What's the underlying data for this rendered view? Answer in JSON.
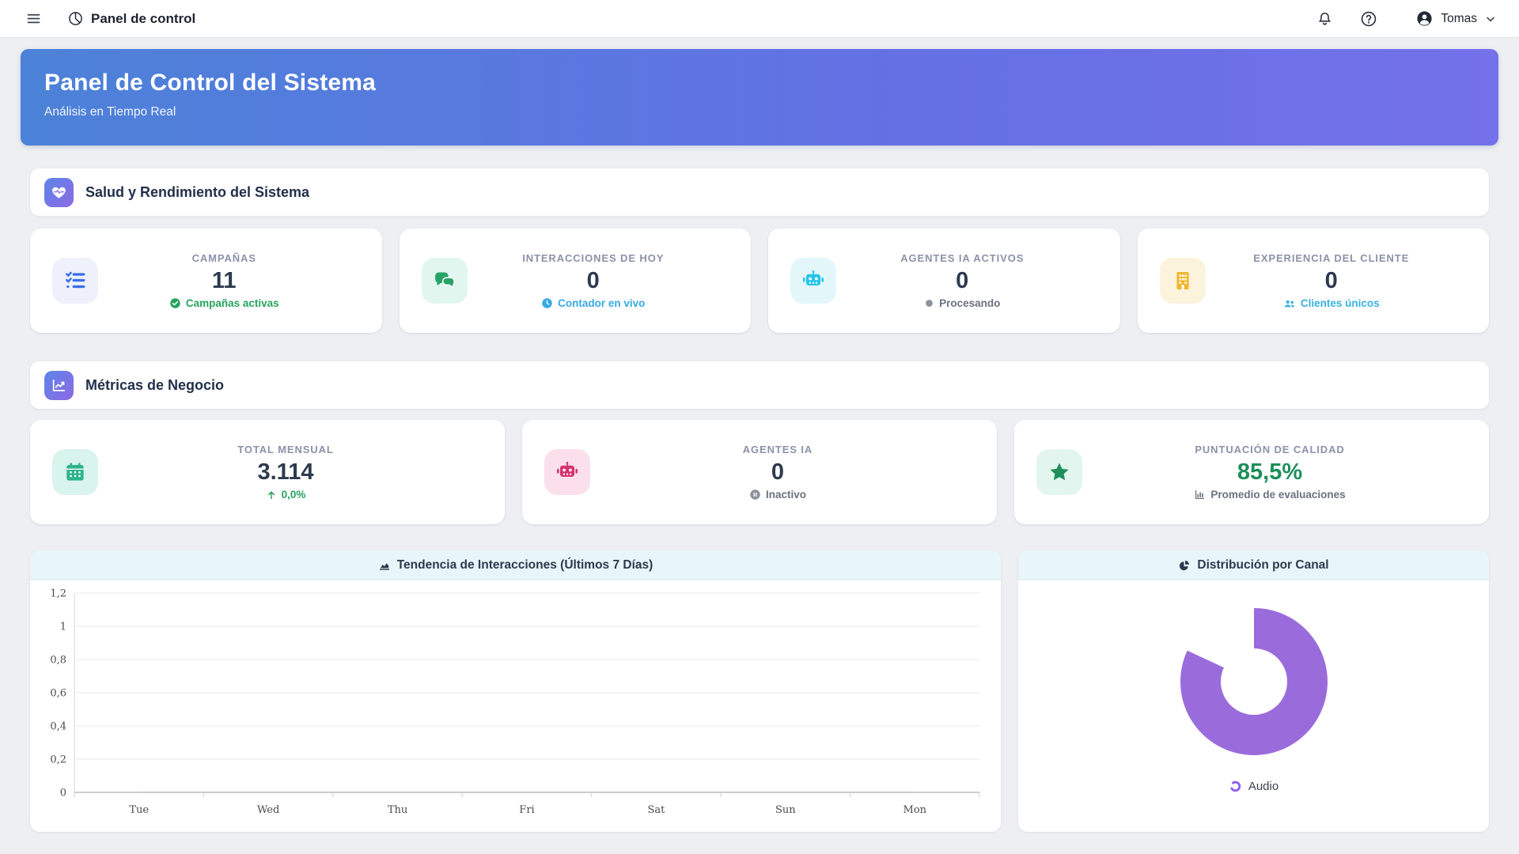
{
  "navbar": {
    "title": "Panel de control",
    "user_name": "Tomas"
  },
  "banner": {
    "title": "Panel de Control del Sistema",
    "subtitle": "Análisis en Tiempo Real"
  },
  "sections": {
    "health": {
      "title": "Salud y Rendimiento del Sistema"
    },
    "business": {
      "title": "Métricas de Negocio"
    }
  },
  "health_cards": [
    {
      "icon": "list-check",
      "label": "CAMPAÑAS",
      "value": "11",
      "status": "Campañas activas",
      "status_icon": "check-circle",
      "icon_bg": "#eef0fb",
      "icon_color": "#3a6ee8",
      "status_color": "#27a35f"
    },
    {
      "icon": "comments",
      "label": "INTERACCIONES DE HOY",
      "value": "0",
      "status": "Contador en vivo",
      "status_icon": "clock",
      "icon_bg": "#e2f6f0",
      "icon_color": "#27a567",
      "status_color": "#38a9e4"
    },
    {
      "icon": "robot",
      "label": "AGENTES IA ACTIVOS",
      "value": "0",
      "status": "Procesando",
      "status_icon": "dot",
      "icon_bg": "#e3f7fb",
      "icon_color": "#27c3ea",
      "status_color": "#6b7280"
    },
    {
      "icon": "building",
      "label": "EXPERIENCIA DEL CLIENTE",
      "value": "0",
      "status": "Clientes únicos",
      "status_icon": "users",
      "icon_bg": "#fcf3dd",
      "icon_color": "#f1b62c",
      "status_color": "#38b2e0"
    }
  ],
  "business_cards": [
    {
      "icon": "calendar",
      "label": "TOTAL MENSUAL",
      "value": "3.114",
      "status": "0,0%",
      "status_icon": "arrow-up",
      "icon_bg": "#d9f4ec",
      "icon_color": "#2bb589",
      "status_color": "#27a35f"
    },
    {
      "icon": "robot",
      "label": "AGENTES IA",
      "value": "0",
      "status": "Inactivo",
      "status_icon": "pause-circle",
      "icon_bg": "#fbe0eb",
      "icon_color": "#d6336c",
      "status_color": "#6b7280"
    },
    {
      "icon": "star",
      "label": "PUNTUACIÓN DE CALIDAD",
      "value": "85,5%",
      "value_color": "#1e8e5a",
      "status": "Promedio de evaluaciones",
      "status_icon": "chart-column",
      "icon_bg": "#e2f5ef",
      "icon_color": "#1e8e5a",
      "status_color": "#6b7280"
    }
  ],
  "chart_data": [
    {
      "type": "line",
      "title": "Tendencia de Interacciones (Últimos 7 Días)",
      "categories": [
        "Tue",
        "Wed",
        "Thu",
        "Fri",
        "Sat",
        "Sun",
        "Mon"
      ],
      "series": [
        {
          "name": "Interacciones",
          "values": [
            0,
            0,
            0,
            0,
            0,
            0,
            0
          ]
        }
      ],
      "xlabel": "",
      "ylabel": "",
      "ylim": [
        0,
        1.2
      ],
      "yticks": [
        0,
        0.2,
        0.4,
        0.6,
        0.8,
        1,
        1.2
      ],
      "ytick_labels": [
        "0",
        "0,2",
        "0,4",
        "0,6",
        "0,8",
        "1",
        "1,2"
      ],
      "grid": true,
      "legend": false
    },
    {
      "type": "donut",
      "title": "Distribución por Canal",
      "segments": [
        {
          "label": "Audio",
          "sweep_deg": 295,
          "color": "#9a6cdb"
        }
      ],
      "legend_position": "bottom"
    }
  ]
}
